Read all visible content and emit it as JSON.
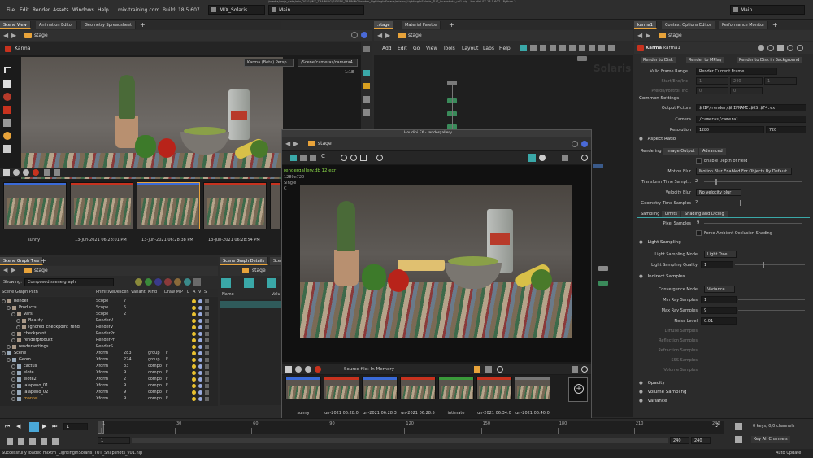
{
  "menubar": {
    "items": [
      "File",
      "Edit",
      "Render",
      "Assets",
      "Windows",
      "Help"
    ],
    "site": "mix-training.com",
    "build": "Build: 18.5.607",
    "desktop": "MIX_Solaris",
    "main_label": "Main",
    "path_title": "/media/projs_data/mix_2021/MIX_TRAINING/SIDEFX_TRAINING/mixtrn_LightingInSolaris/mixtrn_LightingInSolaris_TUT_Snapshots_v01.hip - Houdini FX 18.5.607 - Python 3",
    "main_right": "Main"
  },
  "left_tabs": [
    "Scene View",
    "Animation Editor",
    "Geometry Spreadsheet"
  ],
  "mid_tabs": [
    ".stage",
    "Material Palette"
  ],
  "right_tabs": [
    "karma1",
    "Context Options Editor",
    "Performance Monitor"
  ],
  "viewport": {
    "path": "stage",
    "renderer": "Karma",
    "camera_menu": "Karma (Beta) Persp",
    "camera_path": "/Scene/cameras/camera4",
    "ratio": "1:18"
  },
  "snapshots": {
    "labels": [
      "sunny",
      "13-Jun-2021 06:28:01 PM",
      "13-Jun-2021 06:28:38 PM",
      "13-Jun-2021 06:28:54 PM"
    ]
  },
  "network": {
    "path": "stage",
    "menu": [
      "Add",
      "Edit",
      "Go",
      "View",
      "Tools",
      "Layout",
      "Labs",
      "Help"
    ],
    "watermark": "Solaris"
  },
  "scene_graph": {
    "tabs": [
      "Scene Graph Tree",
      "Scene Graph Details",
      "Scene"
    ],
    "path": "stage",
    "showing_label": "Showing:",
    "showing_value": "Composed scene graph",
    "columns": [
      "Scene Graph Path",
      "Primitive",
      "Descen",
      "Variant",
      "Kind",
      "Draw M",
      "P",
      "L",
      "A",
      "V",
      "S"
    ],
    "rows": [
      {
        "indent": 1,
        "name": "Render",
        "prim": "Scope",
        "desc": "7",
        "kind": "",
        "draw": ""
      },
      {
        "indent": 2,
        "name": "Products",
        "prim": "Scope",
        "desc": "5",
        "kind": "",
        "draw": ""
      },
      {
        "indent": 3,
        "name": "Vars",
        "prim": "Scope",
        "desc": "2",
        "kind": "",
        "draw": ""
      },
      {
        "indent": 4,
        "name": "Beauty",
        "prim": "RenderV",
        "desc": "",
        "kind": "",
        "draw": ""
      },
      {
        "indent": 4,
        "name": "Ignored_checkpoint_rend",
        "prim": "RenderV",
        "desc": "",
        "kind": "",
        "draw": ""
      },
      {
        "indent": 3,
        "name": "checkpoint",
        "prim": "RenderPr",
        "desc": "",
        "kind": "",
        "draw": ""
      },
      {
        "indent": 3,
        "name": "renderproduct",
        "prim": "RenderPr",
        "desc": "",
        "kind": "",
        "draw": ""
      },
      {
        "indent": 2,
        "name": "rendersettings",
        "prim": "RenderS",
        "desc": "",
        "kind": "",
        "draw": ""
      },
      {
        "indent": 1,
        "name": "Scene",
        "prim": "Xform",
        "desc": "283",
        "kind": "group",
        "draw": "F"
      },
      {
        "indent": 2,
        "name": "Geom",
        "prim": "Xform",
        "desc": "274",
        "kind": "group",
        "draw": "F"
      },
      {
        "indent": 3,
        "name": "cactus",
        "prim": "Xform",
        "desc": "33",
        "kind": "compo",
        "draw": "F"
      },
      {
        "indent": 3,
        "name": "elote",
        "prim": "Xform",
        "desc": "9",
        "kind": "compo",
        "draw": "F"
      },
      {
        "indent": 3,
        "name": "elote2",
        "prim": "Xform",
        "desc": "2",
        "kind": "compo",
        "draw": "F"
      },
      {
        "indent": 3,
        "name": "jalapeno_01",
        "prim": "Xform",
        "desc": "9",
        "kind": "compo",
        "draw": "F"
      },
      {
        "indent": 3,
        "name": "jalapeno_02",
        "prim": "Xform",
        "desc": "9",
        "kind": "compo",
        "draw": "F"
      },
      {
        "indent": 3,
        "name": "mantel",
        "prim": "Xform",
        "desc": "9",
        "kind": "compo",
        "draw": "F"
      }
    ]
  },
  "details": {
    "path": "stage",
    "col_name": "Name",
    "col_value": "Valu"
  },
  "gallery": {
    "title": "Houdini FX - rendergallery",
    "path": "stage",
    "file": "rendergallery.db 12.exr",
    "resolution": "1280x720",
    "mode": "Single",
    "channel": "C",
    "source": "Source file: In Memory",
    "thumb_labels": [
      "sunny",
      "un-2021 06:28:0",
      "un-2021 06:28:3",
      "un-2021 06:28:5",
      "intimate",
      "un-2021 06:34:0",
      "un-2021 06:40:0"
    ]
  },
  "karma": {
    "node_type": "Karma",
    "node_name": "karma1",
    "buttons": [
      "Render to Disk",
      "Render to MPlay",
      "Render to Disk in Background"
    ],
    "valid_frame_label": "Valid Frame Range",
    "valid_frame_value": "Render Current Frame",
    "startend_label": "Start/End/Inc",
    "startend_values": [
      "1",
      "240",
      "1"
    ],
    "preroll_label": "Preroll/Postroll Inc",
    "preroll_values": [
      "0",
      "0"
    ],
    "common_settings": "Common Settings",
    "output_label": "Output Picture",
    "output_value": "$HIP/render/$HIPNAME.$OS.$F4.exr",
    "camera_label": "Camera",
    "camera_value": "/cameras/camera1",
    "resolution_label": "Resolution",
    "res_x": "1280",
    "res_y": "720",
    "aspect_ratio": "Aspect Ratio",
    "tabs": [
      "Rendering",
      "Image Output",
      "Advanced"
    ],
    "dof_label": "Enable Depth of Field",
    "motion_blur_label": "Motion Blur",
    "motion_blur_value": "Motion Blur Enabled For Objects By Default",
    "transform_label": "Transform Time Sampl...",
    "transform_value": "2",
    "velocity_label": "Velocity Blur",
    "velocity_value": "No velocity blur",
    "geom_time_label": "Geometry Time Samples",
    "geom_time_value": "2",
    "sub_tabs": [
      "Sampling",
      "Limits",
      "Shading and Dicing"
    ],
    "pixel_samples_label": "Pixel Samples",
    "pixel_samples_value": "9",
    "force_ao": "Force Ambient Occlusion Shading",
    "light_sampling": "Light Sampling",
    "light_mode_label": "Light Sampling Mode",
    "light_mode_value": "Light Tree",
    "light_quality_label": "Light Sampling Quality",
    "light_quality_value": "1",
    "indirect": "Indirect Samples",
    "convergence_label": "Convergence Mode",
    "convergence_value": "Variance",
    "min_ray_label": "Min Ray Samples",
    "min_ray_value": "1",
    "max_ray_label": "Max Ray Samples",
    "max_ray_value": "9",
    "noise_label": "Noise Level",
    "noise_value": "0.01",
    "disabled_labels": [
      "Diffuse Samples",
      "Reflection Samples",
      "Refraction Samples",
      "SSS Samples",
      "Volume Samples"
    ],
    "bottom_sections": [
      "Opacity",
      "Volume Sampling",
      "Variance"
    ]
  },
  "timeline": {
    "frame": "1",
    "start": "1",
    "ticks": [
      "1",
      "30",
      "60",
      "90",
      "120",
      "150",
      "180",
      "210",
      "240"
    ],
    "end_a": "240",
    "end_b": "240",
    "keys": "0 keys, 0/0 channels",
    "key_all": "Key All Channels",
    "auto_update": "Auto Update"
  },
  "status": {
    "message": "Successfully loaded mixtrn_LightingInSolaris_TUT_Snapshots_v01.hip"
  },
  "colors": {
    "accent": "#e8a33a",
    "houdini_red": "#c8321e",
    "tab_active": "#4a4a4a",
    "play_blue": "#4aa8d8"
  }
}
